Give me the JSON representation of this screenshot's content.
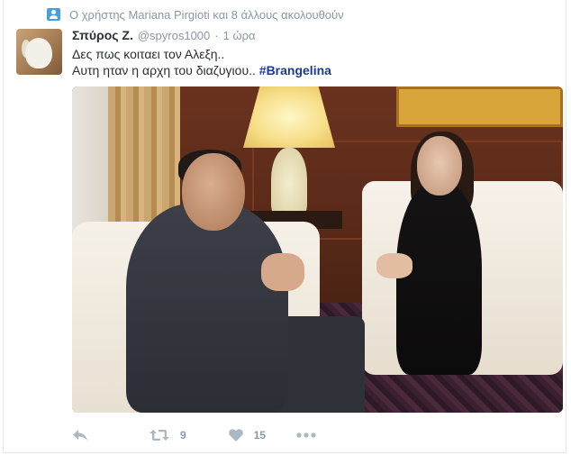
{
  "context": {
    "text": "Ο χρήστης Mariana Pirgioti και 8 άλλους ακολουθούν"
  },
  "tweet": {
    "name": "Σπύρος Ζ.",
    "handle": "@spyros1000",
    "separator": "·",
    "time": "1 ώρα",
    "line1": "Δες πως κοιταει τον Αλεξη..",
    "line2": "Αυτη ηταν η αρχη του διαζυγιου..",
    "hashtag": "#Brangelina"
  },
  "actions": {
    "retweet_count": "9",
    "like_count": "15"
  },
  "icons": {
    "context": "person-follow-icon",
    "reply": "reply-icon",
    "retweet": "retweet-icon",
    "like": "heart-icon",
    "more": "more-dots-icon"
  },
  "colors": {
    "accent": "#1b3a8c",
    "muted": "#8899a6",
    "text": "#292f33"
  }
}
